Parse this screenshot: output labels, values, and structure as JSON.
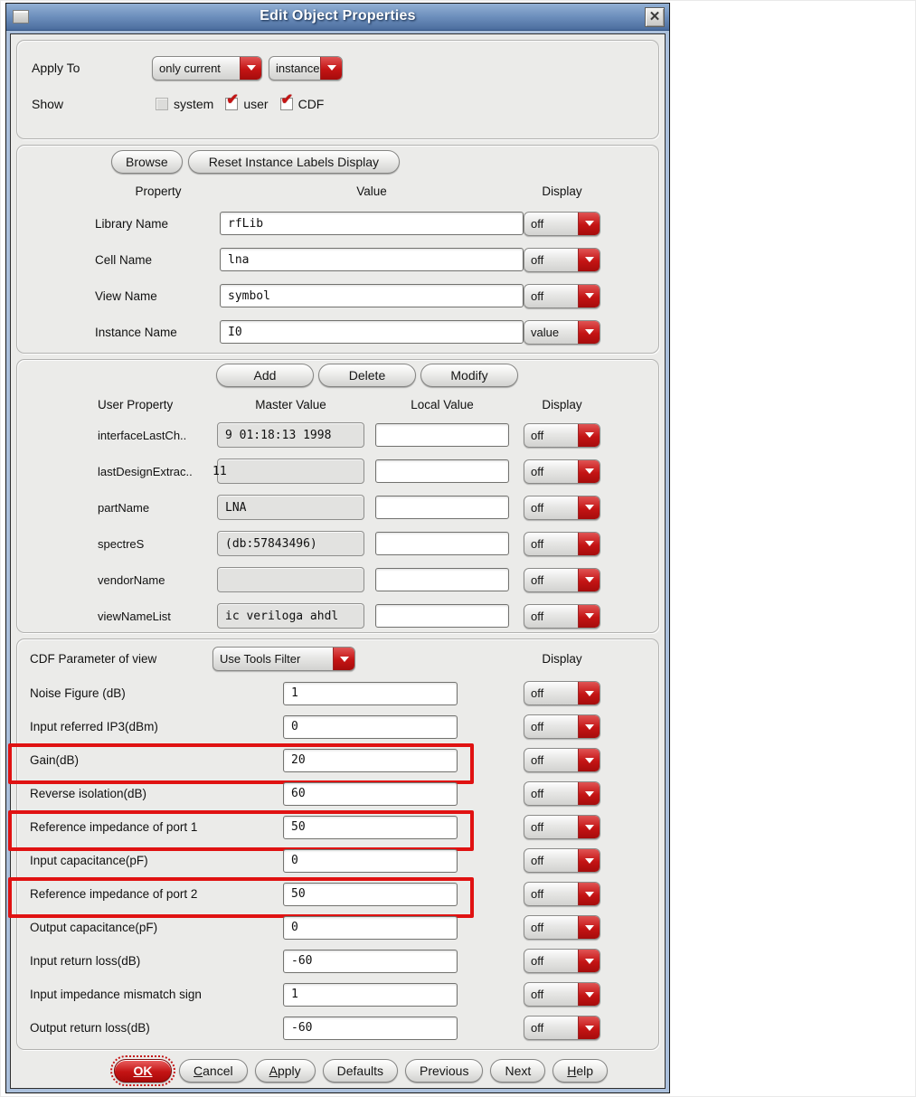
{
  "window": {
    "title": "Edit Object Properties"
  },
  "icons": {
    "close": "✕",
    "checkmark": "✔",
    "dropdown_arrow": "css-triangle-down",
    "window_menu": "raised-square"
  },
  "colors": {
    "accent_red": "#c41414",
    "highlight_red": "#e01212",
    "titlebar_top": "#92b0d4",
    "titlebar_bottom": "#4b6d9e"
  },
  "apply_to": {
    "label": "Apply To",
    "scope": "only current",
    "target": "instance"
  },
  "show": {
    "label": "Show",
    "options": [
      {
        "label": "system",
        "checked": false
      },
      {
        "label": "user",
        "checked": true
      },
      {
        "label": "CDF",
        "checked": true
      }
    ]
  },
  "identity": {
    "browse_label": "Browse",
    "reset_label": "Reset Instance Labels Display",
    "headers": {
      "property": "Property",
      "value": "Value",
      "display": "Display"
    },
    "rows": [
      {
        "label": "Library Name",
        "value": "rfLib",
        "display": "off"
      },
      {
        "label": "Cell Name",
        "value": "lna",
        "display": "off"
      },
      {
        "label": "View Name",
        "value": "symbol",
        "display": "off"
      },
      {
        "label": "Instance Name",
        "value": "I0",
        "display": "value"
      }
    ]
  },
  "user_properties": {
    "add_label": "Add",
    "delete_label": "Delete",
    "modify_label": "Modify",
    "headers": {
      "property": "User Property",
      "master": "Master Value",
      "local": "Local Value",
      "display": "Display"
    },
    "rows": [
      {
        "label": "interfaceLastCh..",
        "master": "9 01:18:13 1998",
        "local": "",
        "display": "off",
        "flush": false
      },
      {
        "label": "lastDesignExtrac..",
        "master": "11",
        "local": "",
        "display": "off",
        "flush": true
      },
      {
        "label": "partName",
        "master": "LNA",
        "local": "",
        "display": "off",
        "flush": false
      },
      {
        "label": "spectreS",
        "master": "(db:57843496)",
        "local": "",
        "display": "off",
        "flush": false
      },
      {
        "label": "vendorName",
        "master": "",
        "local": "",
        "display": "off",
        "flush": false
      },
      {
        "label": "viewNameList",
        "master": "ic veriloga ahdl",
        "local": "",
        "display": "off",
        "flush": false
      }
    ]
  },
  "cdf": {
    "label": "CDF Parameter of view",
    "filter": "Use Tools Filter",
    "display_header": "Display",
    "rows": [
      {
        "label": "Noise Figure (dB)",
        "value": "1",
        "display": "off",
        "highlighted": false
      },
      {
        "label": "Input referred IP3(dBm)",
        "value": "0",
        "display": "off",
        "highlighted": false
      },
      {
        "label": "Gain(dB)",
        "value": "20",
        "display": "off",
        "highlighted": true
      },
      {
        "label": "Reverse isolation(dB)",
        "value": "60",
        "display": "off",
        "highlighted": false
      },
      {
        "label": "Reference impedance of port 1",
        "value": "50",
        "display": "off",
        "highlighted": true
      },
      {
        "label": "Input capacitance(pF)",
        "value": "0",
        "display": "off",
        "highlighted": false
      },
      {
        "label": "Reference impedance of port 2",
        "value": "50",
        "display": "off",
        "highlighted": true
      },
      {
        "label": "Output capacitance(pF)",
        "value": "0",
        "display": "off",
        "highlighted": false
      },
      {
        "label": "Input return loss(dB)",
        "value": "-60",
        "display": "off",
        "highlighted": false
      },
      {
        "label": "Input impedance mismatch sign",
        "value": "1",
        "display": "off",
        "highlighted": false
      },
      {
        "label": "Output return loss(dB)",
        "value": "-60",
        "display": "off",
        "highlighted": false
      }
    ]
  },
  "footer": {
    "buttons": [
      {
        "label": "OK",
        "primary": true,
        "underline": null
      },
      {
        "label": "Cancel",
        "primary": false,
        "underline": 0
      },
      {
        "label": "Apply",
        "primary": false,
        "underline": 0
      },
      {
        "label": "Defaults",
        "primary": false,
        "underline": null
      },
      {
        "label": "Previous",
        "primary": false,
        "underline": null
      },
      {
        "label": "Next",
        "primary": false,
        "underline": null
      },
      {
        "label": "Help",
        "primary": false,
        "underline": 0
      }
    ]
  }
}
